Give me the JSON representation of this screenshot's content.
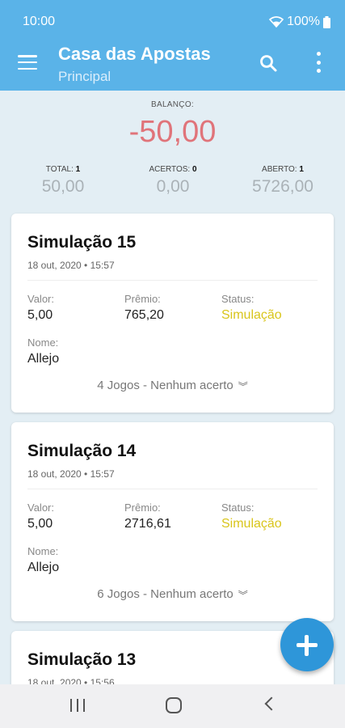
{
  "status_bar": {
    "time": "10:00",
    "battery": "100%",
    "wifi_icon": "wifi-icon",
    "battery_icon": "battery-icon"
  },
  "appbar": {
    "title": "Casa das Apostas",
    "subtitle": "Principal",
    "menu_icon": "menu-icon",
    "search_icon": "search-icon",
    "more_icon": "more-vert-icon"
  },
  "summary": {
    "balance_label": "BALANÇO:",
    "balance_value": "-50,00",
    "total": {
      "label": "TOTAL:",
      "count": "1",
      "value": "50,00"
    },
    "hits": {
      "label": "ACERTOS:",
      "count": "0",
      "value": "0,00"
    },
    "open": {
      "label": "ABERTO:",
      "count": "1",
      "value": "5726,00"
    }
  },
  "cards": [
    {
      "title": "Simulação 15",
      "date": "18 out, 2020 • 15:57",
      "valor_label": "Valor:",
      "valor": "5,00",
      "premio_label": "Prêmio:",
      "premio": "765,20",
      "status_label": "Status:",
      "status": "Simulação",
      "nome_label": "Nome:",
      "nome": "Allejo",
      "footer": "4 Jogos - Nenhum acerto"
    },
    {
      "title": "Simulação 14",
      "date": "18 out, 2020 • 15:57",
      "valor_label": "Valor:",
      "valor": "5,00",
      "premio_label": "Prêmio:",
      "premio": "2716,61",
      "status_label": "Status:",
      "status": "Simulação",
      "nome_label": "Nome:",
      "nome": "Allejo",
      "footer": "6 Jogos - Nenhum acerto"
    },
    {
      "title": "Simulação 13",
      "date": "18 out, 2020 • 15:56"
    }
  ],
  "colors": {
    "appbar": "#5ab3e8",
    "balance_negative": "#e0747a",
    "status_simulacao": "#d9c51b",
    "fab": "#2e96d9"
  },
  "fab_icon": "add-icon"
}
